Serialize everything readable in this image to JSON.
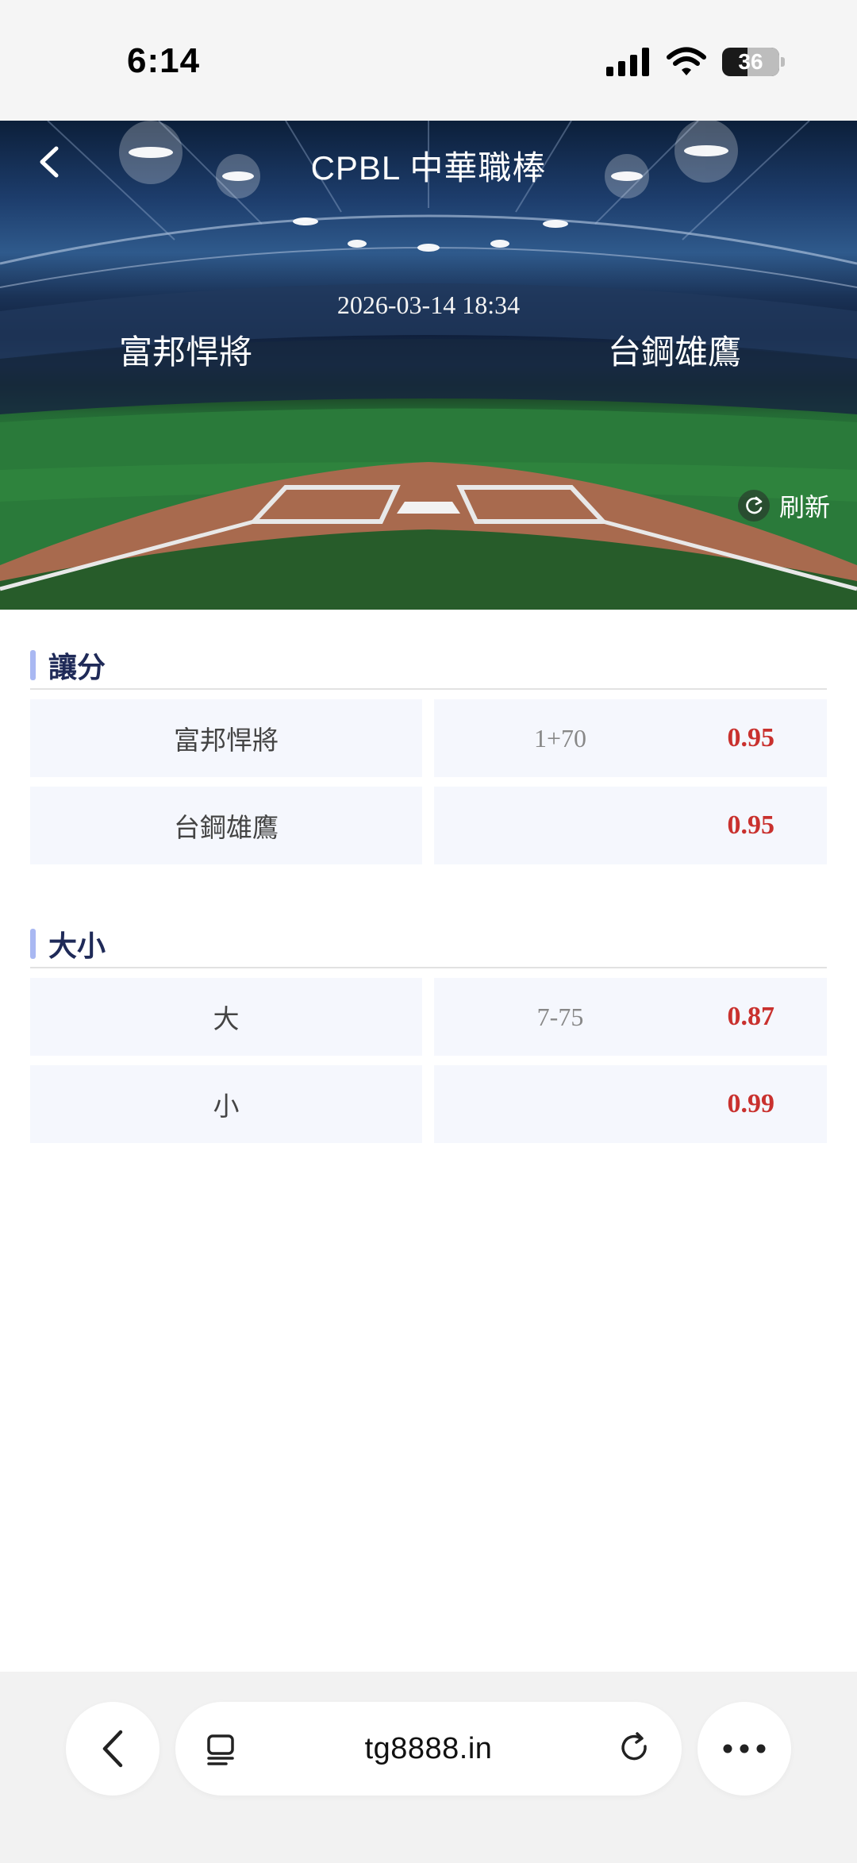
{
  "status_bar": {
    "time": "6:14",
    "battery": "36"
  },
  "header": {
    "title": "CPBL 中華職棒",
    "date": "2026-03-14 18:34",
    "team_home": "富邦悍將",
    "team_away": "台鋼雄鷹",
    "refresh_label": "刷新"
  },
  "sections": [
    {
      "title": "讓分",
      "rows": [
        {
          "label": "富邦悍將",
          "line": "1+70",
          "odds": "0.95"
        },
        {
          "label": "台鋼雄鷹",
          "line": "",
          "odds": "0.95"
        }
      ]
    },
    {
      "title": "大小",
      "rows": [
        {
          "label": "大",
          "line": "7-75",
          "odds": "0.87"
        },
        {
          "label": "小",
          "line": "",
          "odds": "0.99"
        }
      ]
    }
  ],
  "browser": {
    "url": "tg8888.in"
  },
  "colors": {
    "odds": "#c9312e",
    "section_accent": "#a9b8f2",
    "section_title": "#1f2a58",
    "cell_bg": "#f5f7fd"
  }
}
